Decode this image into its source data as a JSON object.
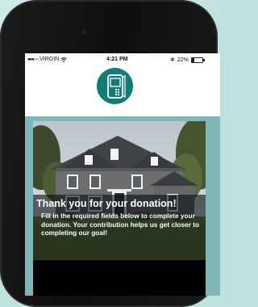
{
  "status_bar": {
    "signal": "●●●○○",
    "carrier": "VIRGIN",
    "time": "4:21 PM",
    "battery_percent": "22%",
    "battery_level": 0.22
  },
  "header": {
    "logo_icon": "phone-device-icon",
    "accent_color": "#137c77"
  },
  "donation_card": {
    "title": "Thank you for your donation!",
    "message": "Fill in the required fields below to complete your donation. Your contribution helps us get closer to completing our goal!"
  }
}
